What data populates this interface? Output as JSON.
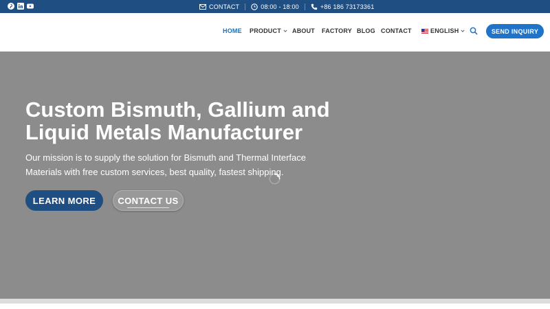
{
  "topbar": {
    "social_icons": [
      "pinterest-icon",
      "linkedin-icon",
      "youtube-icon"
    ],
    "contact_label": "CONTACT",
    "hours": "08:00 - 18:00",
    "phone": "+86 186 73173361"
  },
  "nav": {
    "items": [
      {
        "label": "HOME",
        "active": true
      },
      {
        "label": "PRODUCT",
        "dropdown": true
      },
      {
        "label": "ABOUT"
      },
      {
        "label": "FACTORY"
      },
      {
        "label": "BLOG"
      },
      {
        "label": "CONTACT"
      }
    ],
    "language": "ENGLISH",
    "search_icon": "search-icon",
    "inquiry_label": "SEND INQUIRY"
  },
  "hero": {
    "title": "Custom Bismuth, Gallium and Liquid Metals Manufacturer",
    "subtitle": "Our mission is to supply the solution for Bismuth and Thermal Interface Materials with free custom services, best quality, fastest shipping.",
    "primary_button": "LEARN MORE",
    "secondary_button": "CONTACT US"
  },
  "colors": {
    "topbar": "#1f4e82",
    "accent": "#1f73c8",
    "hero_bg": "#8c8c8c"
  }
}
